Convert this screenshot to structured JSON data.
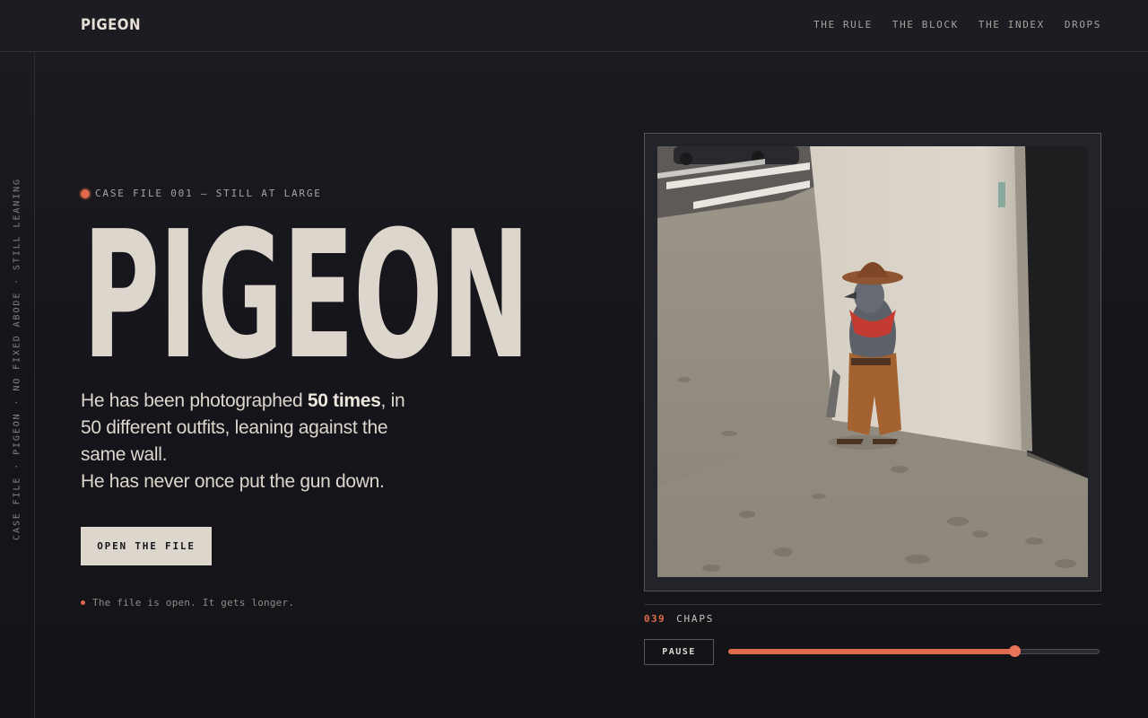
{
  "header": {
    "brand": "PIGEON",
    "nav": [
      "THE RULE",
      "THE BLOCK",
      "THE INDEX",
      "DROPS"
    ]
  },
  "rail": {
    "text": "CASE FILE · PIGEON · NO FIXED ABODE · STILL LEANING"
  },
  "hero": {
    "eyebrow": "CASE FILE 001 — STILL AT LARGE",
    "title": "PIGEON",
    "lede_a": "He has been photographed ",
    "lede_bold": "50 times",
    "lede_b": ", in 50 different outfits, leaning against the same wall.",
    "lede_c": "He has never once put the gun down.",
    "cta_label": "OPEN THE FILE",
    "note": "The file is open. It gets longer."
  },
  "gallery": {
    "counter": "039",
    "caption": "CHAPS",
    "pause_label": "PAUSE",
    "progress": 0.77
  },
  "colors": {
    "accent": "#e06b4c",
    "background": "#16161c",
    "cream": "#ddd6cc"
  }
}
